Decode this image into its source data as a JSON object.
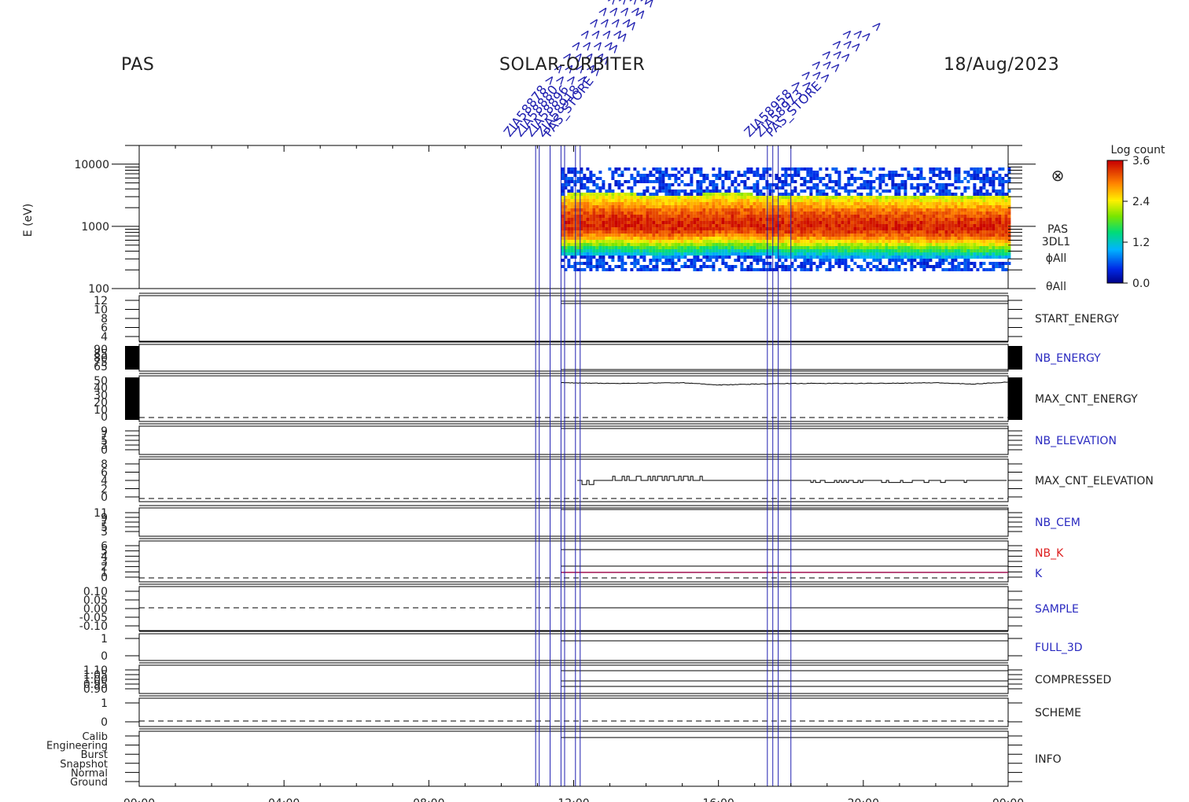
{
  "header": {
    "instrument": "PAS",
    "mission": "SOLAR-ORBITER",
    "date": "18/Aug/2023"
  },
  "colors": {
    "axis": "#000000",
    "event_line": "#2020b0",
    "label_blue": "#2a2ac0",
    "label_red": "#dd2020",
    "k_line": "#a01050"
  },
  "spectrogram": {
    "ylabel": "E (eV)",
    "y_ticks": [
      "10000",
      "1000",
      "100"
    ],
    "side_labels": [
      "PAS",
      "3DL1",
      "ϕAll",
      "θAll"
    ],
    "colorbar_title": "Log count",
    "colorbar_ticks": [
      "3.6",
      "2.4",
      "1.2",
      "0.0"
    ],
    "symbol": "⊗"
  },
  "x_axis": {
    "ticks": [
      "00:00",
      "04:00",
      "08:00",
      "12:00",
      "16:00",
      "20:00",
      "00:00"
    ]
  },
  "panels": [
    {
      "label": "START_ENERGY",
      "ticks": [
        "12",
        "10",
        "8",
        "6",
        "4"
      ],
      "label_color": "black"
    },
    {
      "label": "NB_ENERGY",
      "ticks": [
        "90",
        "85",
        "80",
        "75",
        "65"
      ],
      "label_color": "blue"
    },
    {
      "label": "MAX_CNT_ENERGY",
      "ticks": [
        "50",
        "40",
        "30",
        "20",
        "10",
        "0"
      ],
      "label_color": "black"
    },
    {
      "label": "NB_ELEVATION",
      "ticks": [
        "9",
        "7",
        "5",
        "3",
        "0"
      ],
      "label_color": "blue"
    },
    {
      "label": "MAX_CNT_ELEVATION",
      "ticks": [
        "8",
        "6",
        "4",
        "2",
        "0"
      ],
      "label_color": "black"
    },
    {
      "label": "NB_CEM",
      "ticks": [
        "11",
        "9",
        "7",
        "5",
        "3"
      ],
      "label_color": "blue"
    },
    {
      "label": "NB_K",
      "label2": "K",
      "ticks": [
        "6",
        "5",
        "4",
        "3",
        "2",
        "1",
        "0"
      ],
      "label_color": "red"
    },
    {
      "label": "SAMPLE",
      "ticks": [
        "0.10",
        "0.05",
        "0.00",
        "-0.05",
        "-0.10"
      ],
      "label_color": "blue"
    },
    {
      "label": "FULL_3D",
      "ticks": [
        "1",
        "0"
      ],
      "label_color": "blue"
    },
    {
      "label": "COMPRESSED",
      "ticks": [
        "1.10",
        "1.05",
        "1.00",
        "0.95",
        "0.90"
      ],
      "label_color": "black"
    },
    {
      "label": "SCHEME",
      "ticks": [
        "1",
        "0"
      ],
      "label_color": "black"
    },
    {
      "label": "INFO",
      "ticks": [
        "Calib",
        "Engineering",
        "Burst",
        "Snapshot",
        "Normal",
        "Ground"
      ],
      "label_color": "black"
    }
  ],
  "chart_data": {
    "type": "heatmap",
    "title": "SOLAR-ORBITER",
    "xlabel": "",
    "ylabel": "E (eV)",
    "x_range_hours": [
      0,
      24
    ],
    "y_range_eV": [
      100,
      20000
    ],
    "y_scale": "log",
    "colorbar_range": [
      0.0,
      3.6
    ],
    "data_start_hour": 11.65,
    "energy_band_peak_eV": [
      {
        "t": 11.7,
        "e": 1100
      },
      {
        "t": 13.0,
        "e": 1150
      },
      {
        "t": 14.5,
        "e": 1050
      },
      {
        "t": 15.5,
        "e": 1100
      },
      {
        "t": 16.0,
        "e": 1150
      },
      {
        "t": 18.0,
        "e": 1050
      },
      {
        "t": 20.0,
        "e": 1050
      },
      {
        "t": 22.5,
        "e": 1000
      },
      {
        "t": 24.0,
        "e": 1000
      }
    ],
    "max_cnt_energy": [
      {
        "t": 11.7,
        "v": 47
      },
      {
        "t": 13.0,
        "v": 46
      },
      {
        "t": 15.0,
        "v": 47
      },
      {
        "t": 16.0,
        "v": 44
      },
      {
        "t": 18.0,
        "v": 46
      },
      {
        "t": 20.0,
        "v": 46
      },
      {
        "t": 22.0,
        "v": 47
      },
      {
        "t": 23.0,
        "v": 45
      },
      {
        "t": 24.0,
        "v": 48
      }
    ],
    "max_cnt_elevation_baseline": 4,
    "k_value": 1,
    "event_lines_hours": [
      10.95,
      11.05,
      11.35,
      11.65,
      11.75,
      12.05,
      12.18,
      17.35,
      17.5,
      17.65,
      18.0
    ]
  }
}
